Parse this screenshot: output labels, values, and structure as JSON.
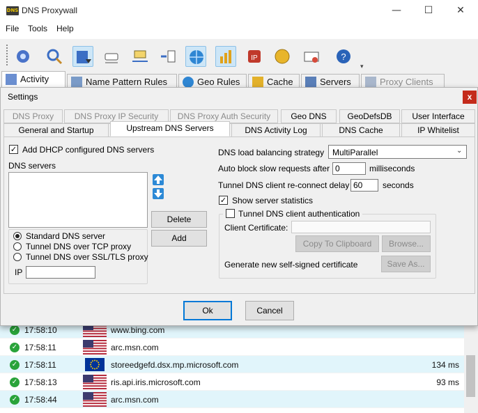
{
  "app": {
    "title": "DNS Proxywall",
    "icon_text": "DNS"
  },
  "window_controls": {
    "minimize": "—",
    "maximize": "☐",
    "close": "✕"
  },
  "menu": [
    "File",
    "Tools",
    "Help"
  ],
  "toolbar_icons": [
    "settings-gear-icon",
    "search-icon",
    "filter-icon",
    "eraser-icon",
    "transfer-icon",
    "export-arrows-icon",
    "globe-icon",
    "bar-chart-icon",
    "ip-block-icon",
    "coins-icon",
    "certificate-icon",
    "help-icon"
  ],
  "main_tabs": [
    {
      "label": "Activity",
      "icon": "activity-icon"
    },
    {
      "label": "Name Pattern Rules",
      "icon": "rules-icon"
    },
    {
      "label": "Geo Rules",
      "icon": "geo-icon"
    },
    {
      "label": "Cache",
      "icon": "cache-icon"
    },
    {
      "label": "Servers",
      "icon": "servers-icon"
    },
    {
      "label": "Proxy Clients",
      "icon": "proxy-clients-icon"
    }
  ],
  "dialog": {
    "title": "Settings",
    "close": "x",
    "tabs_row1": [
      "DNS Proxy",
      "DNS Proxy IP Security",
      "DNS Proxy Auth Security",
      "Geo DNS",
      "GeoDefsDB",
      "User Interface"
    ],
    "tabs_row2": [
      "General and Startup",
      "Upstream DNS Servers",
      "DNS Activity Log",
      "DNS Cache",
      "IP Whitelist"
    ],
    "active_tab": "Upstream DNS Servers",
    "left": {
      "dhcp_label": "Add DHCP configured DNS servers",
      "dhcp_checked": true,
      "servers_label": "DNS servers",
      "delete_button": "Delete",
      "add_button": "Add",
      "radio_options": [
        "Standard DNS server",
        "Tunnel DNS over TCP proxy",
        "Tunnel DNS over SSL/TLS proxy"
      ],
      "radio_selected": 0,
      "ip_label": "IP",
      "ip_value": ""
    },
    "right": {
      "lb_label": "DNS load balancing strategy",
      "lb_value": "MultiParallel",
      "autoblock_label": "Auto block slow requests after",
      "autoblock_value": "0",
      "autoblock_unit": "milliseconds",
      "reconnect_label": "Tunnel DNS client re-connect delay",
      "reconnect_value": "60",
      "reconnect_unit": "seconds",
      "show_stats_label": "Show server statistics",
      "show_stats_checked": true,
      "tunnel_auth_label": "Tunnel DNS client authentication",
      "tunnel_auth_checked": false,
      "client_cert_label": "Client Certificate:",
      "client_cert_value": "",
      "copy_button": "Copy To Clipboard",
      "browse_button": "Browse...",
      "generate_label": "Generate new self-signed certificate",
      "saveas_button": "Save As..."
    },
    "ok_button": "Ok",
    "cancel_button": "Cancel"
  },
  "log_rows": [
    {
      "time": "17:58:10",
      "flag": "us",
      "host": "www.bing.com",
      "ms": ""
    },
    {
      "time": "17:58:11",
      "flag": "us",
      "host": "arc.msn.com",
      "ms": ""
    },
    {
      "time": "17:58:11",
      "flag": "eu",
      "host": "storeedgefd.dsx.mp.microsoft.com",
      "ms": "134 ms"
    },
    {
      "time": "17:58:13",
      "flag": "us",
      "host": "ris.api.iris.microsoft.com",
      "ms": "93 ms"
    },
    {
      "time": "17:58:44",
      "flag": "us",
      "host": "arc.msn.com",
      "ms": ""
    }
  ],
  "colors": {
    "accent": "#0078d7",
    "close_red": "#c42b1c",
    "selected_row": "#e1f5fb",
    "ok_green": "#29a33a"
  }
}
